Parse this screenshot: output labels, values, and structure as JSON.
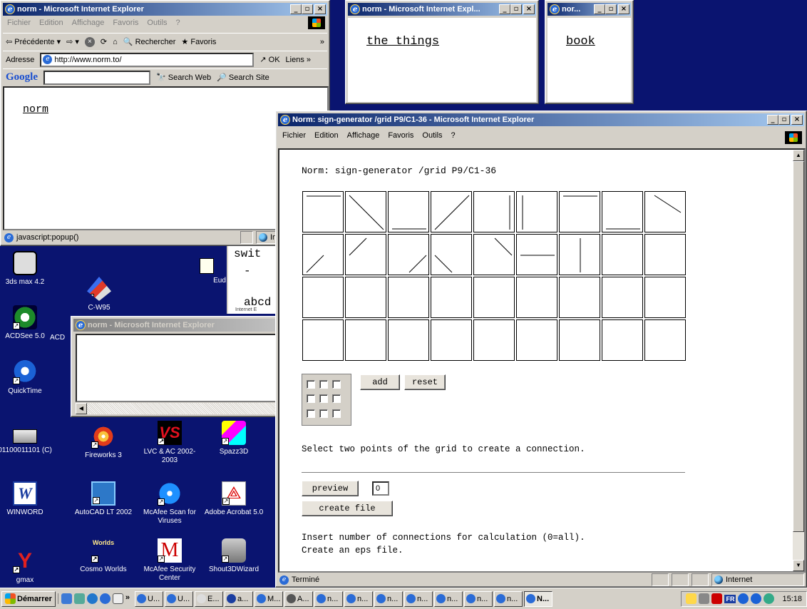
{
  "colors": {
    "desktop": "#0a1470",
    "title_active": "#0a246a",
    "title_inactive": "#808080"
  },
  "main_window": {
    "title": "norm - Microsoft Internet Explorer",
    "menu": [
      "Fichier",
      "Edition",
      "Affichage",
      "Favoris",
      "Outils",
      "?"
    ],
    "toolbar": {
      "back": "Précédente",
      "search": "Rechercher",
      "favorites": "Favoris"
    },
    "address": {
      "label": "Adresse",
      "value": "http://www.norm.to/",
      "go": "OK",
      "links": "Liens"
    },
    "google": {
      "brand": "Google",
      "search_web": "Search Web",
      "search_site": "Search Site"
    },
    "content_text": "norm",
    "status": {
      "text": "javascript:popup()",
      "zone": "Internet"
    }
  },
  "popup_things": {
    "title": "norm - Microsoft Internet Expl...",
    "text": "the things"
  },
  "popup_book": {
    "title": "nor...",
    "text": "book"
  },
  "bg_window_fragment": {
    "text1": "swit",
    "text2": "-",
    "text3": "abcd",
    "text4": "Internet E"
  },
  "small_window": {
    "title": "norm - Microsoft Internet Explorer"
  },
  "generator_window": {
    "title": "Norm: sign-generator /grid P9/C1-36 - Microsoft Internet Explorer",
    "menu": [
      "Fichier",
      "Edition",
      "Affichage",
      "Favoris",
      "Outils",
      "?"
    ],
    "heading": "Norm: sign-generator /grid P9/C1-36",
    "add_label": "add",
    "reset_label": "reset",
    "instruction": "Select two points of the grid to create a connection.",
    "preview_label": "preview",
    "count_value": "0",
    "create_label": "create file",
    "help_line1": "Insert number of connections for calculation (0=all).",
    "help_line2": "Create an eps file.",
    "status": {
      "text": "Terminé",
      "zone": "Internet"
    },
    "cells": [
      "top",
      "diag-down",
      "bottom",
      "diag-up",
      "right",
      "left",
      "top",
      "bottom",
      "diag-down-half",
      "diag-up-bottomleft",
      "diag-up-topleft",
      "diag-up-bottomright",
      "diag-down-bottomleft",
      "diag-down-topright",
      "mid-h",
      "mid-v",
      "",
      "",
      "",
      "",
      "",
      "",
      "",
      "",
      "",
      "",
      "",
      "",
      "",
      "",
      "",
      "",
      "",
      "",
      "",
      ""
    ]
  },
  "desktop_icons": [
    {
      "label": "3ds max 4.2"
    },
    {
      "label": "C-W95"
    },
    {
      "label": "Eud"
    },
    {
      "label": "ACDSee 5.0"
    },
    {
      "label": "ACD"
    },
    {
      "label": "QuickTime"
    },
    {
      "label": "01100011101 (C)"
    },
    {
      "label": "Fireworks 3"
    },
    {
      "label": "LVC & AC 2002-2003"
    },
    {
      "label": "Spazz3D"
    },
    {
      "label": "WINWORD"
    },
    {
      "label": "AutoCAD LT 2002"
    },
    {
      "label": "McAfee Scan for Viruses"
    },
    {
      "label": "Adobe Acrobat 5.0"
    },
    {
      "label": "gmax"
    },
    {
      "label": "Cosmo Worlds"
    },
    {
      "label": "McAfee Security Center"
    },
    {
      "label": "Shout3DWizard"
    }
  ],
  "taskbar": {
    "start": "Démarrer",
    "chevron": "»",
    "items": [
      "U...",
      "U...",
      "E...",
      "a...",
      "M...",
      "A...",
      "n...",
      "n...",
      "n...",
      "n...",
      "n...",
      "n...",
      "n...",
      "N..."
    ],
    "tray_lang": "FR",
    "clock": "15:18"
  }
}
